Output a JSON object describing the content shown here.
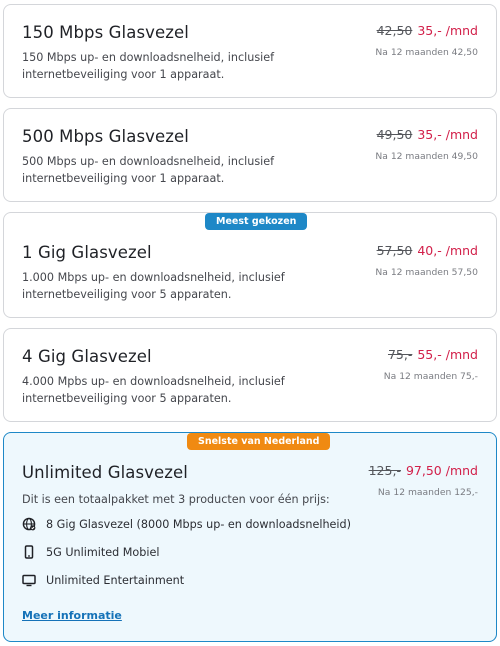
{
  "plans": [
    {
      "title": "150 Mbps Glasvezel",
      "description": "150 Mbps up- en downloadsnelheid, inclusief internetbeveiliging voor 1 apparaat.",
      "old_price": "42,50",
      "new_price": "35,-",
      "per": "/mnd",
      "after": "Na 12 maanden 42,50"
    },
    {
      "title": "500 Mbps Glasvezel",
      "description": "500 Mbps up- en downloadsnelheid, inclusief internetbeveiliging voor 1 apparaat.",
      "old_price": "49,50",
      "new_price": "35,-",
      "per": "/mnd",
      "after": "Na 12 maanden 49,50"
    },
    {
      "badge": "Meest gekozen",
      "title": "1 Gig Glasvezel",
      "description": "1.000 Mbps up- en downloadsnelheid, inclusief internetbeveiliging voor 5 apparaten.",
      "old_price": "57,50",
      "new_price": "40,-",
      "per": "/mnd",
      "after": "Na 12 maanden 57,50"
    },
    {
      "title": "4 Gig Glasvezel",
      "description": "4.000 Mpbs up- en downloadsnelheid, inclusief internetbeveiliging voor 5 apparaten.",
      "old_price": "75,-",
      "new_price": "55,-",
      "per": "/mnd",
      "after": "Na 12 maanden 75,-"
    },
    {
      "badge": "Snelste van Nederland",
      "title": "Unlimited Glasvezel",
      "description": "Dit is een totaalpakket met 3 producten voor één prijs:",
      "old_price": "125,-",
      "new_price": "97,50",
      "per": "/mnd",
      "after": "Na 12 maanden 125,-",
      "features": [
        {
          "icon": "globe-icon",
          "label": "8 Gig Glasvezel (8000 Mbps up- en downloadsnelheid)"
        },
        {
          "icon": "phone-icon",
          "label": "5G Unlimited Mobiel"
        },
        {
          "icon": "tv-icon",
          "label": "Unlimited Entertainment"
        }
      ],
      "link": "Meer informatie"
    }
  ],
  "colors": {
    "price_accent": "#d2204a",
    "badge_blue": "#1e88c7",
    "badge_orange": "#f08a12",
    "highlight_bg": "#eef8fd",
    "link": "#1572b8"
  }
}
